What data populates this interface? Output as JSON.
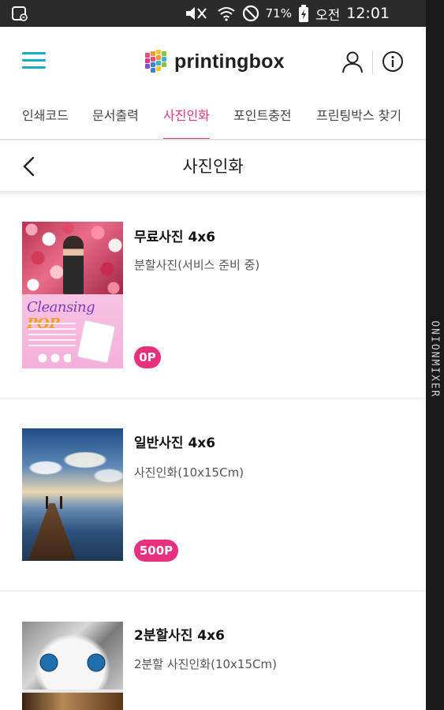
{
  "status_bar": {
    "battery_percent": "71%",
    "ampm": "오전",
    "time": "12:01",
    "icons": [
      "notification-icon",
      "mute-icon",
      "wifi-icon",
      "do-not-disturb-icon",
      "battery-charging-icon"
    ]
  },
  "header": {
    "brand": "printingbox",
    "menu_icon": "hamburger-menu-icon",
    "user_icon": "user-icon",
    "info_icon": "info-icon",
    "accent_color": "#17a9c6"
  },
  "tabs": [
    {
      "label": "인쇄코드",
      "active": false
    },
    {
      "label": "문서출력",
      "active": false
    },
    {
      "label": "사진인화",
      "active": true
    },
    {
      "label": "포인트충전",
      "active": false
    },
    {
      "label": "프린팅박스 찾기",
      "active": false
    }
  ],
  "page": {
    "title": "사진인화",
    "back_icon": "chevron-left-icon"
  },
  "products": [
    {
      "title": "무료사진 4x6",
      "description": "분할사진(서비스 준비 중)",
      "points": "0P",
      "thumb_text": "Cleansing",
      "thumb_text_accent": "POP"
    },
    {
      "title": "일반사진 4x6",
      "description": "사진인화(10x15Cm)",
      "points": "500P"
    },
    {
      "title": "2분할사진 4x6",
      "description": "2분할 사진인화(10x15Cm)"
    }
  ],
  "watermark": "ONIONMIXER",
  "colors": {
    "accent_pink": "#e8317e",
    "status_bar": "#2b2b2b"
  }
}
